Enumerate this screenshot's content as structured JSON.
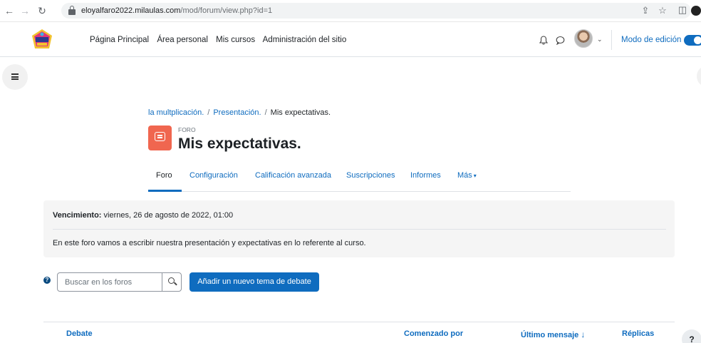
{
  "browser": {
    "url_host": "eloyalfaro2022.milaulas.com",
    "url_path": "/mod/forum/view.php?id=1",
    "back_icon": "arrow-left-icon",
    "forward_icon": "arrow-right-icon",
    "reload_icon": "reload-icon"
  },
  "navbar": {
    "items": [
      {
        "label": "Página Principal"
      },
      {
        "label": "Área personal"
      },
      {
        "label": "Mis cursos"
      },
      {
        "label": "Administración del sitio"
      }
    ],
    "edit_mode_label": "Modo de edición",
    "edit_mode_on": true
  },
  "breadcrumb": {
    "course": "la multplicación.",
    "section": "Presentación.",
    "current": "Mis expectativas.",
    "separator": "/"
  },
  "header": {
    "activity_type": "FORO",
    "title": "Mis expectativas.",
    "icon_color": "#f0664f"
  },
  "secondary_nav": {
    "tabs": [
      {
        "label": "Foro"
      },
      {
        "label": "Configuración"
      },
      {
        "label": "Calificación avanzada"
      },
      {
        "label": "Suscripciones"
      },
      {
        "label": "Informes"
      },
      {
        "label": "Más"
      }
    ],
    "active_index": 0
  },
  "info": {
    "due_label": "Vencimiento:",
    "due_value": "viernes, 26 de agosto de 2022, 01:00",
    "description": "En este foro vamos a escribir nuestra presentación y expectativas en lo referente al curso."
  },
  "search": {
    "placeholder": "Buscar en los foros"
  },
  "actions": {
    "add_topic": "Añadir un nuevo tema de debate"
  },
  "table": {
    "columns": [
      {
        "label": "Debate"
      },
      {
        "label": "Comenzado por"
      },
      {
        "label": "Último mensaje"
      },
      {
        "label": "Réplicas"
      }
    ],
    "sort_indicator": "↓"
  },
  "help_fab": "?",
  "colors": {
    "primary": "#0f6cbf",
    "text": "#1d2125"
  }
}
